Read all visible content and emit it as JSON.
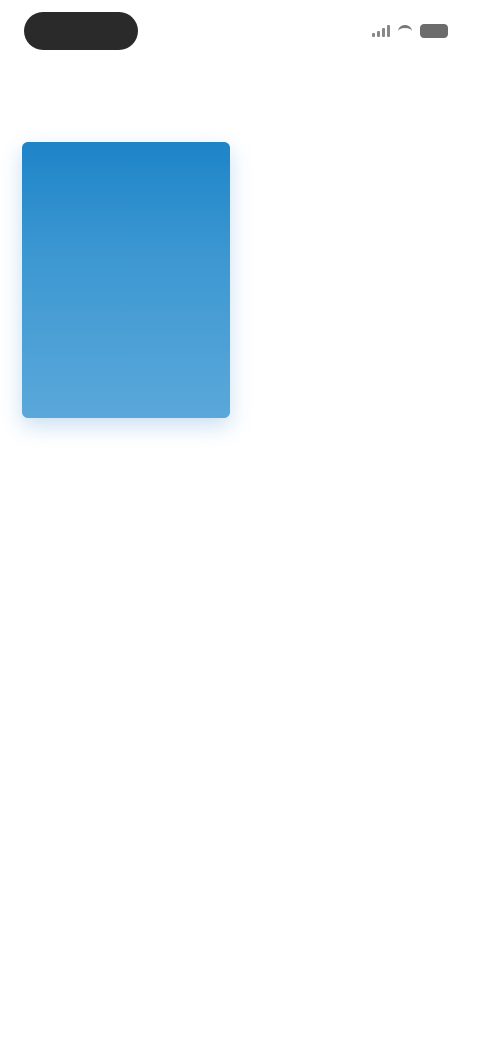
{
  "status_bar": {
    "time": "",
    "icons": [
      "signal-icon",
      "wifi-icon",
      "battery-icon"
    ]
  },
  "header": {
    "title": ""
  },
  "book": {
    "cover_title": "",
    "cover_subtitle": "",
    "caption": "",
    "cover_colors": [
      "#1d84c8",
      "#5aa8da"
    ]
  },
  "bottom_action": {
    "label": "",
    "color": "#f07b43"
  }
}
